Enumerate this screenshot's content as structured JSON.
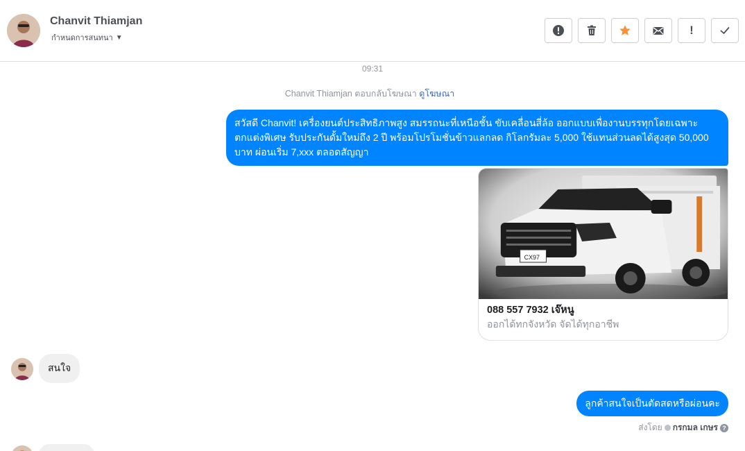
{
  "header": {
    "name": "Chanvit Thiamjan",
    "subtitle": "กำหนดการสนทนา",
    "toolbar": [
      {
        "icon": "exclamation-circle-icon"
      },
      {
        "icon": "trash-icon"
      },
      {
        "icon": "star-icon",
        "color": "#f7923b"
      },
      {
        "icon": "envelope-icon"
      },
      {
        "icon": "exclamation-icon",
        "glyph": "!"
      },
      {
        "icon": "check-icon"
      }
    ]
  },
  "chat": {
    "timestamp": "09:31",
    "reply_note": {
      "text": "Chanvit Thiamjan ตอบกลับโฆษณา",
      "link": "ดูโฆษณา"
    },
    "messages": {
      "ad_text": "สวัสดี Chanvit! เครื่องยนต์ประสิทธิภาพสูง สมรรถนะที่เหนือชั้น ขับเคลื่อนสี่ล้อ ออกแบบเพื่องานบรรทุกโดยเฉพาะ ตกแต่งพิเศษ รับประกันดั้มใหม่ถึง 2 ปี พร้อมโปรโมชั่นข้าวแลกลด กิโลกรัมละ 5,000 ใช้แทนส่วนลดได้สูงสุด 50,000 บาท ผ่อนเริ่ม 7,xxx ตลอดสัญญา",
      "ad_card": {
        "plate": "CX97",
        "title": "088 557 7932 เจ๊หนู",
        "description": "ออกได้ทกจังหวัด จัดได้ทุกอาชีพ"
      },
      "incoming": "สนใจ",
      "reply": "ลูกค้าสนใจเป็นตัดสดหรือผ่อนคะ"
    },
    "sent_by": {
      "label": "ส่งโดย",
      "who": "กรกมล เกษร"
    }
  },
  "colors": {
    "accent": "#0084ff",
    "incoming_bubble": "#f1f0f0",
    "link": "#4267b2"
  }
}
